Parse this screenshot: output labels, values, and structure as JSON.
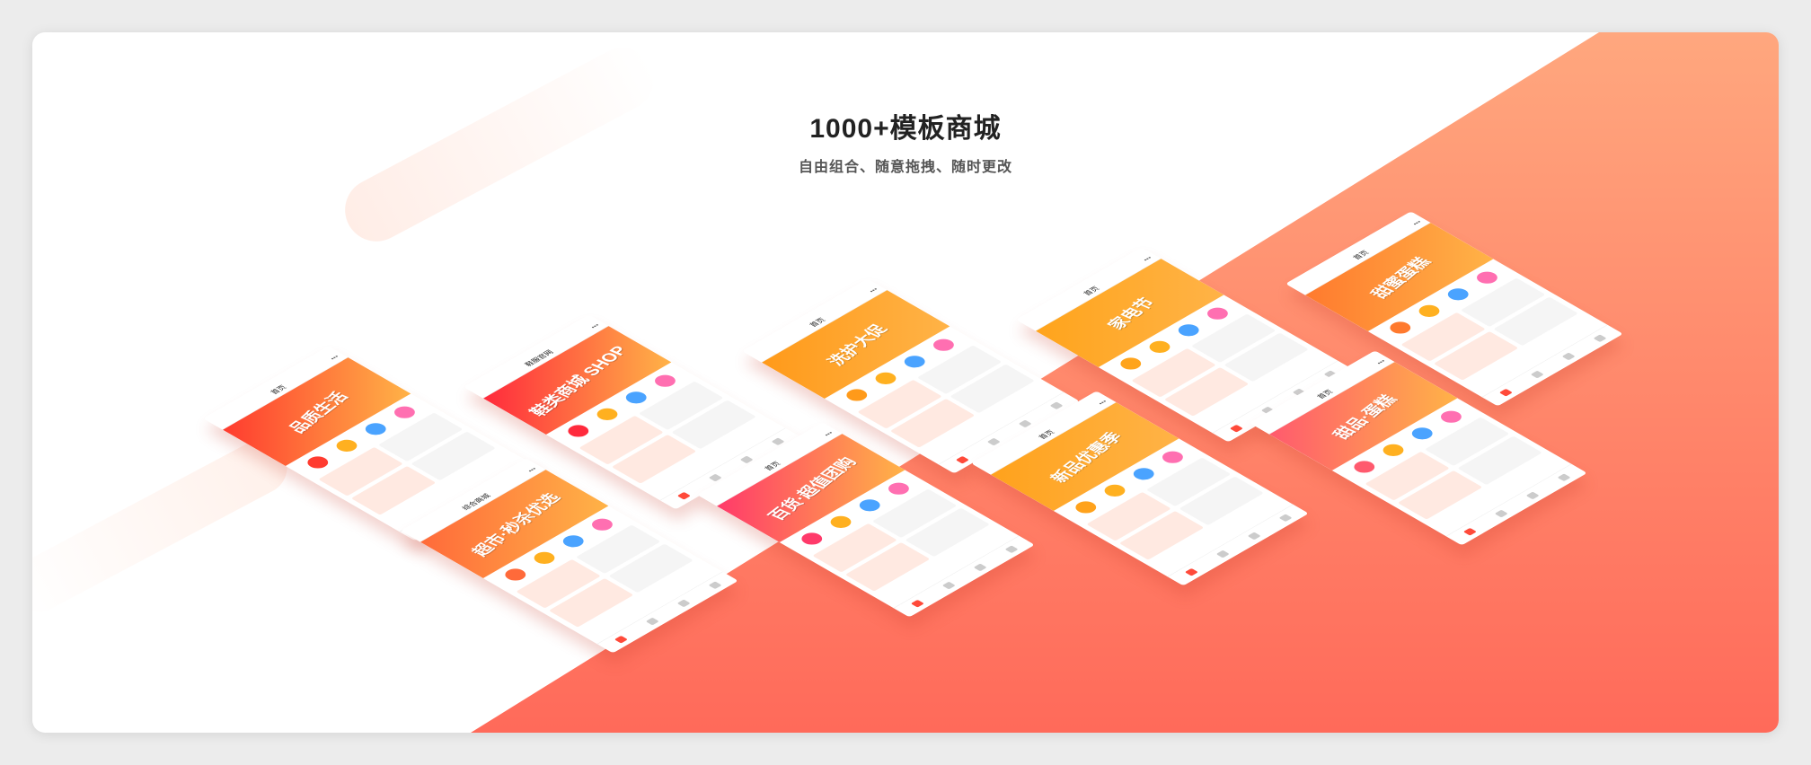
{
  "hero": {
    "title": "1000+模板商城",
    "subtitle": "自由组合、随意拖拽、随时更改"
  },
  "colors": {
    "gradient_top": "#ffa77e",
    "gradient_bottom": "#ff6a5a",
    "accent": "#ff4a3a"
  },
  "phones": [
    {
      "nav_title": "首页",
      "banner_text": "品质生活",
      "theme": "#ff3b2f"
    },
    {
      "nav_title": "鞋服官网",
      "banner_text": "鞋类商城 SHOP",
      "theme": "#ff2a3c"
    },
    {
      "nav_title": "首页",
      "banner_text": "洗护大促",
      "theme": "#ff9a1a"
    },
    {
      "nav_title": "首页",
      "banner_text": "家电节",
      "theme": "#ffa41c"
    },
    {
      "nav_title": "首页",
      "banner_text": "甜蜜蛋糕",
      "theme": "#ff7a2e"
    },
    {
      "nav_title": "综合商城",
      "banner_text": "超市·秒杀优选",
      "theme": "#ff6a3a"
    },
    {
      "nav_title": "首页",
      "banner_text": "百货·超值团购",
      "theme": "#ff3a6a"
    },
    {
      "nav_title": "首页",
      "banner_text": "新品优惠季",
      "theme": "#ffa21c"
    },
    {
      "nav_title": "首页",
      "banner_text": "甜品·蛋糕",
      "theme": "#ff5a6e"
    }
  ]
}
